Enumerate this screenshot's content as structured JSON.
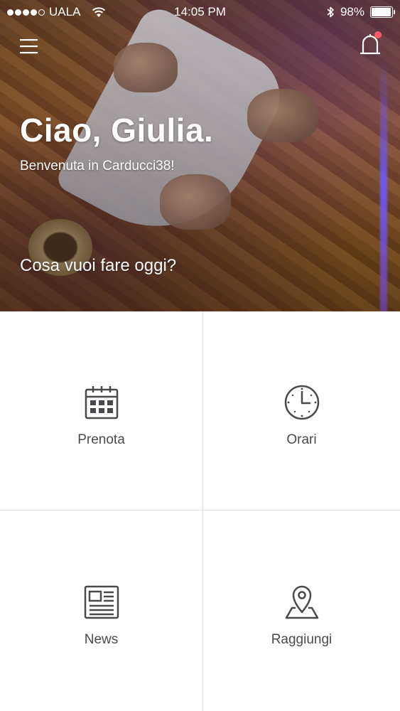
{
  "status_bar": {
    "carrier": "UALA",
    "time": "14:05 PM",
    "battery": "98%",
    "battery_level": 0.98,
    "signal_bars": 4,
    "signal_max": 5
  },
  "header": {
    "menu_icon": "hamburger-menu-icon",
    "notification_icon": "bell-icon",
    "has_notification": true,
    "notification_color": "#ff5a5f"
  },
  "hero": {
    "greeting": "Ciao, Giulia.",
    "welcome": "Benvenuta in Carducci38!",
    "question": "Cosa vuoi fare oggi?"
  },
  "actions": [
    {
      "label": "Prenota",
      "icon": "calendar-icon"
    },
    {
      "label": "Orari",
      "icon": "clock-icon"
    },
    {
      "label": "News",
      "icon": "newspaper-icon"
    },
    {
      "label": "Raggiungi",
      "icon": "location-pin-icon"
    }
  ],
  "colors": {
    "icon": "#4a4a4e",
    "divider": "#e2e2e2",
    "text_on_hero": "#ffffff"
  }
}
